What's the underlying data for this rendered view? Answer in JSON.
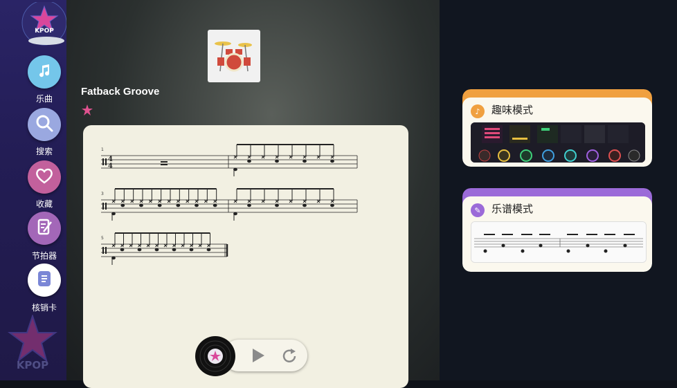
{
  "sidebar": {
    "logo_text": "KPOP",
    "items": [
      {
        "label": "乐曲",
        "icon": "music-note-icon",
        "color": "#74c6ea"
      },
      {
        "label": "搜索",
        "icon": "search-icon",
        "color": "#9aa8e0"
      },
      {
        "label": "收藏",
        "icon": "heart-icon",
        "color": "#c2609c"
      },
      {
        "label": "节拍器",
        "icon": "metronome-icon",
        "color": "#a367b8"
      },
      {
        "label": "核销卡",
        "icon": "card-icon",
        "color": "#ffffff"
      }
    ]
  },
  "song": {
    "title": "Fatback Groove",
    "measure_numbers": [
      "1",
      "3",
      "5"
    ]
  },
  "player": {
    "play_icon": "play-icon",
    "replay_icon": "replay-icon",
    "disc_icon": "vinyl-disc-icon"
  },
  "modes": [
    {
      "title": "趣味模式",
      "accent": "#f0a040",
      "icon": "music-note-icon"
    },
    {
      "title": "乐谱模式",
      "accent": "#9b6ad8",
      "icon": "score-edit-icon"
    }
  ]
}
